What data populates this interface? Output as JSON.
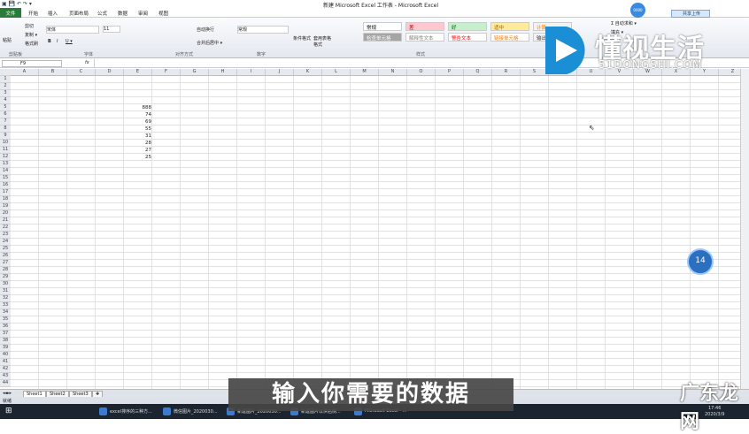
{
  "window": {
    "title": "新建 Microsoft Excel 工作表 - Microsoft Excel",
    "quick_access": "▣ 💾 ↶ ↷ ▾"
  },
  "tabs": [
    "文件",
    "开始",
    "插入",
    "页面布局",
    "公式",
    "数据",
    "审阅",
    "视图"
  ],
  "ribbon": {
    "clipboard": {
      "paste": "粘贴",
      "cut": "剪切",
      "copy": "复制 ▾",
      "format_painter": "格式刷",
      "group": "剪贴板"
    },
    "font": {
      "name": "宋体",
      "size": "11",
      "bold": "B",
      "italic": "I",
      "underline": "U ▾",
      "group": "字体"
    },
    "alignment": {
      "wrap": "自动换行",
      "merge": "合并后居中 ▾",
      "group": "对齐方式"
    },
    "number": {
      "format": "常规",
      "group": "数字"
    },
    "styles": {
      "conditional": "条件格式",
      "table": "套用表格格式",
      "group": "样式",
      "cells": [
        {
          "label": "常规",
          "bg": "#ffffff",
          "color": "#000"
        },
        {
          "label": "差",
          "bg": "#ffc7ce",
          "color": "#9c0006"
        },
        {
          "label": "好",
          "bg": "#c6efce",
          "color": "#006100"
        },
        {
          "label": "适中",
          "bg": "#ffeb9c",
          "color": "#9c6500"
        },
        {
          "label": "计算",
          "bg": "#f2f2f2",
          "color": "#fa7d00"
        },
        {
          "label": "检查单元格",
          "bg": "#a5a5a5",
          "color": "#fff"
        },
        {
          "label": "解释性文本",
          "bg": "#ffffff",
          "color": "#7f7f7f"
        },
        {
          "label": "警告文本",
          "bg": "#ffffff",
          "color": "#ff0000"
        },
        {
          "label": "链接单元格",
          "bg": "#ffffff",
          "color": "#fa7d00"
        },
        {
          "label": "输出",
          "bg": "#f2f2f2",
          "color": "#3f3f3f"
        }
      ]
    },
    "editing": {
      "autosum": "Σ 自动求和 ▾",
      "fill": "填充 ▾"
    },
    "share": "共享上传",
    "circle": "0000"
  },
  "formula_bar": {
    "name_box": "F9",
    "fx": "fx",
    "value": ""
  },
  "columns": [
    "A",
    "B",
    "C",
    "D",
    "E",
    "F",
    "G",
    "H",
    "I",
    "J",
    "K",
    "L",
    "M",
    "N",
    "O",
    "P",
    "Q",
    "R",
    "S",
    "T",
    "U",
    "V",
    "W",
    "X",
    "Y",
    "Z"
  ],
  "row_count": 44,
  "cells": [
    {
      "row": 5,
      "value": "888"
    },
    {
      "row": 6,
      "value": "74"
    },
    {
      "row": 7,
      "value": "69"
    },
    {
      "row": 8,
      "value": "55"
    },
    {
      "row": 9,
      "value": "31"
    },
    {
      "row": 10,
      "value": "28"
    },
    {
      "row": 11,
      "value": "27"
    },
    {
      "row": 12,
      "value": "25"
    }
  ],
  "sheets": [
    "Sheet1",
    "Sheet2",
    "Sheet3"
  ],
  "status": "就绪",
  "taskbar": [
    "excel排序的三种方...",
    "微信图片_2020030...",
    "新建图片_2020030...",
    "新建图片以供右侧...",
    "Microsoft Excel - ..."
  ],
  "clock": {
    "time": "17:46",
    "date": "2020/3/9"
  },
  "overlay": {
    "subtitle": "输入你需要的数据",
    "watermark": "广东龙网",
    "logo_text": "懂视生活",
    "logo_sub": "51DONGSHI.COM",
    "badge": "14"
  }
}
